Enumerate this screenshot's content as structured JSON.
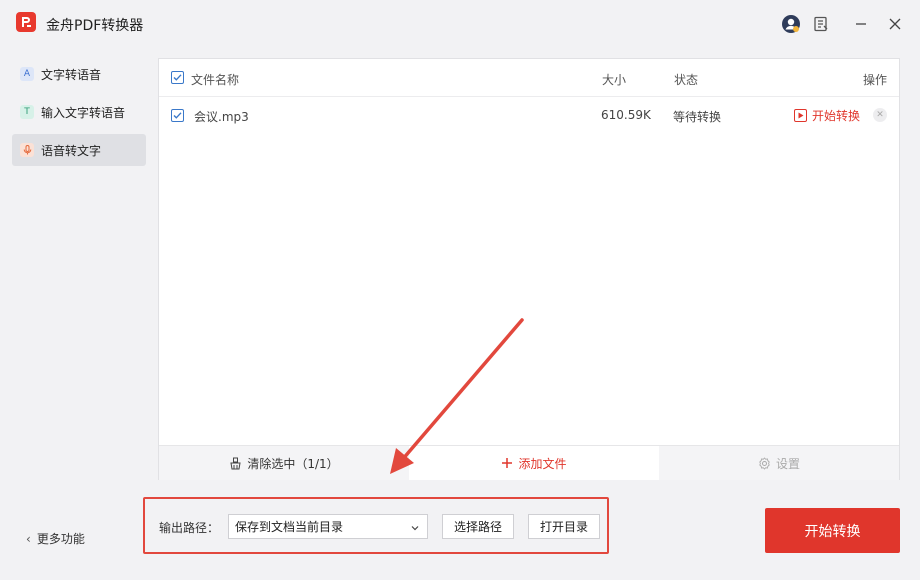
{
  "app": {
    "title": "金舟PDF转换器"
  },
  "sidebar": {
    "items": [
      {
        "label": "文字转语音",
        "icon": "text-a-icon"
      },
      {
        "label": "输入文字转语音",
        "icon": "text-input-icon"
      },
      {
        "label": "语音转文字",
        "icon": "microphone-icon"
      }
    ],
    "more_label": "更多功能"
  },
  "table": {
    "headers": {
      "name": "文件名称",
      "size": "大小",
      "status": "状态",
      "action": "操作"
    },
    "rows": [
      {
        "name": "会议.mp3",
        "size": "610.59K",
        "status": "等待转换",
        "action": "开始转换"
      }
    ]
  },
  "panel_footer": {
    "clear_label": "清除选中（1/1）",
    "add_label": "添加文件",
    "settings_label": "设置"
  },
  "output": {
    "label": "输出路径：",
    "selected_option": "保存到文档当前目录",
    "choose_path_label": "选择路径",
    "open_dir_label": "打开目录"
  },
  "convert_button": {
    "label": "开始转换"
  },
  "colors": {
    "accent": "#e0362c",
    "checkbox": "#3a78c9",
    "highlight": "#e2483d"
  }
}
